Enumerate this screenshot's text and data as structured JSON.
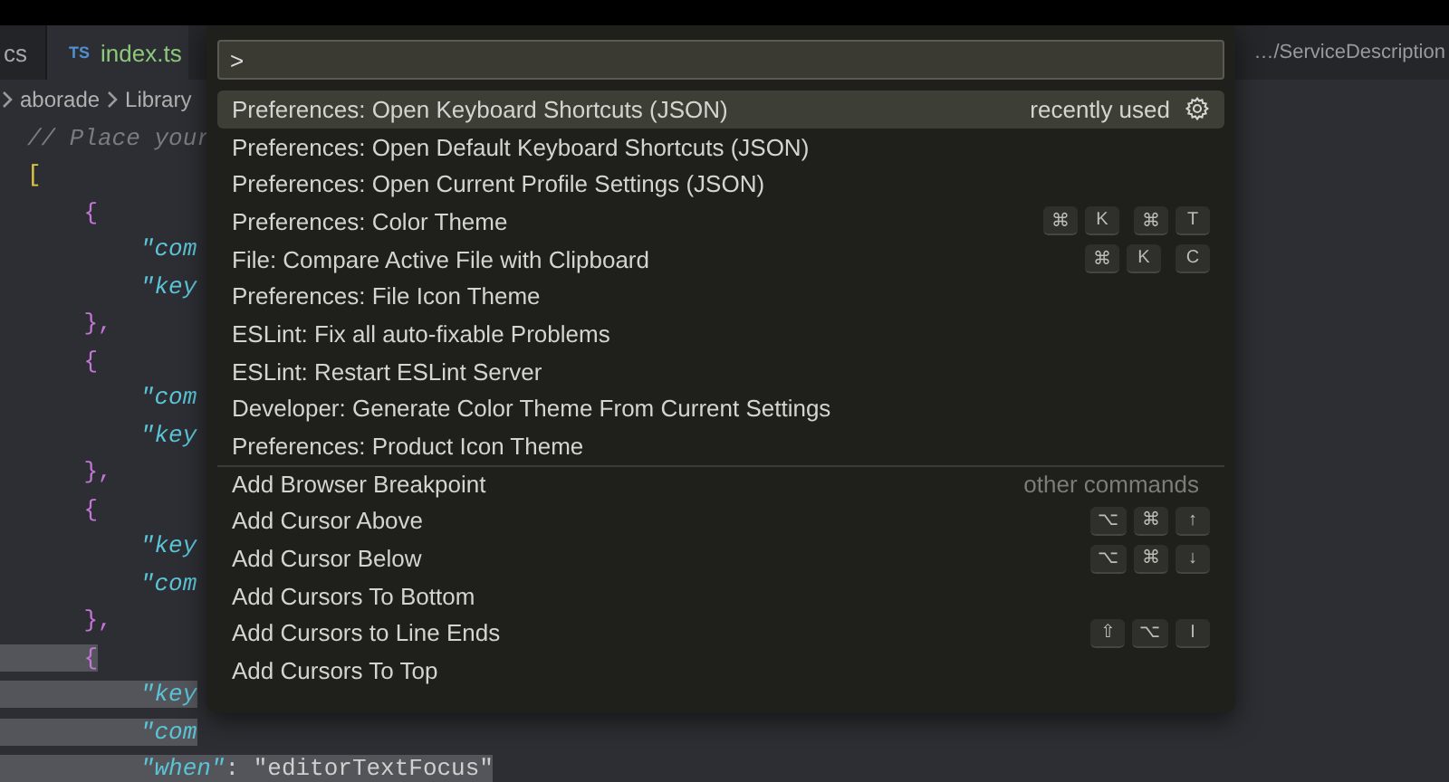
{
  "tabs": [
    {
      "label": "cs",
      "selected": false
    },
    {
      "label": "index.ts",
      "icon": "TS",
      "selected": true
    }
  ],
  "path_hint": "…/ServiceDescription",
  "breadcrumb": [
    "aborade",
    "Library"
  ],
  "code_lines": [
    {
      "text": "// Place your",
      "kind": "comment",
      "highlighted": false
    },
    {
      "text": "[",
      "kind": "bracket",
      "highlighted": false
    },
    {
      "text": "    {",
      "kind": "brace",
      "highlighted": false
    },
    {
      "text": "        \"com",
      "kind": "key",
      "highlighted": false
    },
    {
      "text": "        \"key",
      "kind": "key",
      "highlighted": false
    },
    {
      "text": "    },",
      "kind": "brace",
      "highlighted": false
    },
    {
      "text": "    {",
      "kind": "brace",
      "highlighted": false
    },
    {
      "text": "        \"com",
      "kind": "key",
      "highlighted": false
    },
    {
      "text": "        \"key",
      "kind": "key",
      "highlighted": false
    },
    {
      "text": "    },",
      "kind": "brace",
      "highlighted": false
    },
    {
      "text": "    {",
      "kind": "brace",
      "highlighted": false
    },
    {
      "text": "        \"key",
      "kind": "key",
      "highlighted": false
    },
    {
      "text": "        \"com",
      "kind": "key",
      "highlighted": false
    },
    {
      "text": "    },",
      "kind": "brace",
      "highlighted": false
    },
    {
      "text": "    {",
      "kind": "brace",
      "highlighted": true
    },
    {
      "text": "        \"key",
      "kind": "key",
      "highlighted": true
    },
    {
      "text": "        \"com",
      "kind": "key",
      "highlighted": true
    },
    {
      "text": "        \"when\": \"editorTextFocus\"",
      "kind": "pair",
      "highlighted": true
    }
  ],
  "palette": {
    "input": {
      "value": ">"
    },
    "items": [
      {
        "label": "Preferences: Open Keyboard Shortcuts (JSON)",
        "hint": "recently used",
        "selected": true,
        "separator_above": false
      },
      {
        "label": "Preferences: Open Default Keyboard Shortcuts (JSON)",
        "selected": false,
        "separator_above": false
      },
      {
        "label": "Preferences: Open Current Profile Settings (JSON)",
        "selected": false,
        "separator_above": false
      },
      {
        "label": "Preferences: Color Theme",
        "selected": false,
        "separator_above": false,
        "keys": [
          [
            "⌘",
            "K"
          ],
          [
            "⌘",
            "T"
          ]
        ]
      },
      {
        "label": "File: Compare Active File with Clipboard",
        "selected": false,
        "separator_above": false,
        "keys": [
          [
            "⌘",
            "K"
          ],
          [
            "C"
          ]
        ]
      },
      {
        "label": "Preferences: File Icon Theme",
        "selected": false,
        "separator_above": false
      },
      {
        "label": "ESLint: Fix all auto-fixable Problems",
        "selected": false,
        "separator_above": false
      },
      {
        "label": "ESLint: Restart ESLint Server",
        "selected": false,
        "separator_above": false
      },
      {
        "label": "Developer: Generate Color Theme From Current Settings",
        "selected": false,
        "separator_above": false
      },
      {
        "label": "Preferences: Product Icon Theme",
        "selected": false,
        "separator_above": false
      },
      {
        "label": "Add Browser Breakpoint",
        "hint": "other commands",
        "selected": false,
        "separator_above": true
      },
      {
        "label": "Add Cursor Above",
        "selected": false,
        "separator_above": false,
        "keys": [
          [
            "⌥",
            "⌘",
            "↑"
          ]
        ]
      },
      {
        "label": "Add Cursor Below",
        "selected": false,
        "separator_above": false,
        "keys": [
          [
            "⌥",
            "⌘",
            "↓"
          ]
        ]
      },
      {
        "label": "Add Cursors To Bottom",
        "selected": false,
        "separator_above": false
      },
      {
        "label": "Add Cursors to Line Ends",
        "selected": false,
        "separator_above": false,
        "keys": [
          [
            "⇧",
            "⌥",
            "I"
          ]
        ]
      },
      {
        "label": "Add Cursors To Top",
        "selected": false,
        "separator_above": false
      }
    ]
  }
}
